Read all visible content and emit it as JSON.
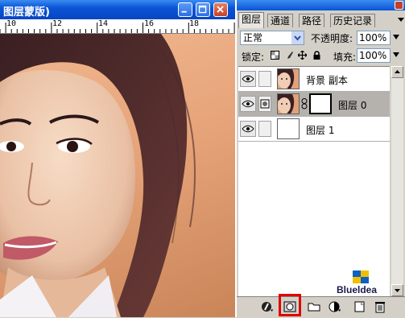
{
  "document": {
    "title": "图层蒙版)",
    "ruler_labels": [
      "10",
      "12",
      "14",
      "16",
      "18"
    ]
  },
  "palette": {
    "tabs": [
      {
        "label": "图层",
        "active": true
      },
      {
        "label": "通道",
        "active": false
      },
      {
        "label": "路径",
        "active": false
      },
      {
        "label": "历史记录",
        "active": false
      }
    ],
    "blend_mode": "正常",
    "opacity_label": "不透明度:",
    "opacity_value": "100%",
    "lock_label": "锁定:",
    "fill_label": "填充:",
    "fill_value": "100%",
    "layers": [
      {
        "name": "背景 副本",
        "selected": false,
        "visible": true
      },
      {
        "name": "图层 0",
        "selected": true,
        "visible": true
      },
      {
        "name": "图层 1",
        "selected": false,
        "visible": true
      }
    ],
    "watermark": "Blueldea",
    "bottom_icons": [
      "layer-style-icon",
      "add-mask-icon",
      "new-group-icon",
      "adjustment-layer-icon",
      "new-layer-icon",
      "trash-icon"
    ],
    "highlight_color": "#e00000"
  }
}
